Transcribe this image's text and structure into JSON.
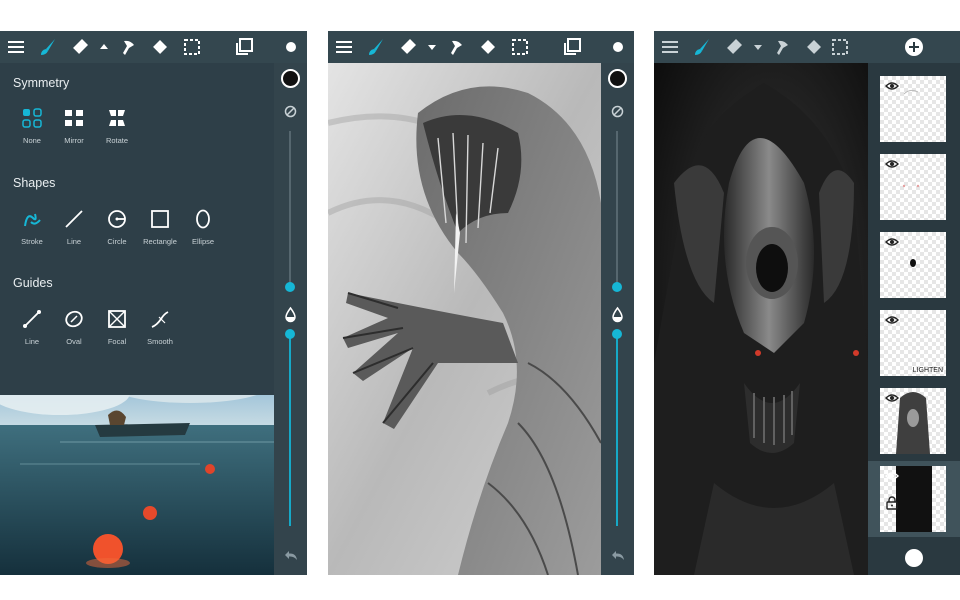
{
  "colors": {
    "accent": "#16b7d6",
    "toolbar": "#34474f",
    "panel": "#2e3f48"
  },
  "screens": [
    {
      "id": "symmetry-menu",
      "toolbar_icons": [
        "menu-icon",
        "brush-icon",
        "eraser-icon",
        "caret-up-icon",
        "smudge-icon",
        "fill-icon",
        "selection-icon",
        "layers-icon",
        "color-dot-icon"
      ],
      "menu": {
        "symmetry": {
          "title": "Symmetry",
          "tools": [
            "None",
            "Mirror",
            "Rotate"
          ]
        },
        "shapes": {
          "title": "Shapes",
          "tools": [
            "Stroke",
            "Line",
            "Circle",
            "Rectangle",
            "Ellipse"
          ]
        },
        "guides": {
          "title": "Guides",
          "tools": [
            "Line",
            "Oval",
            "Focal",
            "Smooth"
          ]
        }
      },
      "rail": {
        "size_level": 0.45,
        "opacity_level": 0.3
      }
    },
    {
      "id": "drawing-canvas",
      "toolbar_icons": [
        "menu-icon",
        "brush-icon",
        "eraser-icon",
        "caret-down-icon",
        "smudge-icon",
        "fill-icon",
        "selection-icon",
        "layers-icon",
        "color-dot-icon"
      ],
      "rail": {
        "size_level": 0.45,
        "opacity_level": 0.3
      }
    },
    {
      "id": "layers-panel",
      "toolbar_icons": [
        "menu-icon",
        "brush-icon",
        "eraser-icon",
        "caret-down-icon",
        "smudge-icon",
        "fill-icon",
        "selection-icon"
      ],
      "layers": [
        {
          "visible": true,
          "tag": ""
        },
        {
          "visible": true,
          "tag": ""
        },
        {
          "visible": true,
          "tag": ""
        },
        {
          "visible": true,
          "tag": "LIGHTEN"
        },
        {
          "visible": true,
          "tag": ""
        },
        {
          "visible": true,
          "tag": "",
          "locked": true,
          "selected": true
        }
      ]
    }
  ]
}
